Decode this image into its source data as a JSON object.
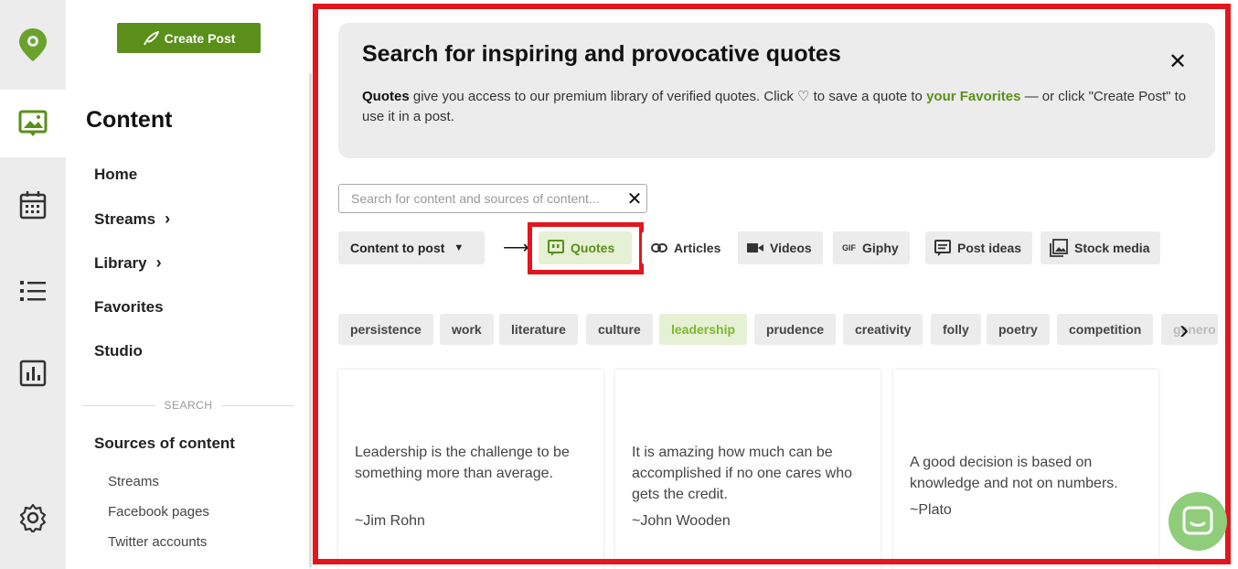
{
  "sidebar": {
    "create_post": "Create Post",
    "title": "Content",
    "nav": [
      {
        "label": "Home"
      },
      {
        "label": "Streams"
      },
      {
        "label": "Library"
      },
      {
        "label": "Favorites"
      },
      {
        "label": "Studio"
      }
    ],
    "search_divider": "SEARCH",
    "sources_heading": "Sources of content",
    "sources": [
      "Streams",
      "Facebook pages",
      "Twitter accounts"
    ]
  },
  "banner": {
    "title": "Search for inspiring and provocative quotes",
    "text_bold": "Quotes",
    "text_1": " give you access to our premium library of verified quotes. Click ♡ to save a quote to ",
    "text_link": "your Favorites",
    "text_2": " — or click \"Create Post\" to use it in a post."
  },
  "search": {
    "placeholder": "Search for content and sources of content..."
  },
  "content_dropdown": {
    "label": "Content to post"
  },
  "tabs": [
    {
      "label": "Quotes",
      "icon": "quote-icon"
    },
    {
      "label": "Articles",
      "icon": "link-icon"
    },
    {
      "label": "Videos",
      "icon": "video-icon"
    },
    {
      "label": "Giphy",
      "icon": "gif-icon"
    },
    {
      "label": "Post ideas",
      "icon": "post-ideas-icon"
    },
    {
      "label": "Stock media",
      "icon": "image-icon"
    }
  ],
  "tags": [
    "persistence",
    "work",
    "literature",
    "culture",
    "leadership",
    "prudence",
    "creativity",
    "folly",
    "poetry",
    "competition",
    "genero"
  ],
  "selected_tag": "leadership",
  "cards": [
    {
      "quote": "Leadership is the challenge to be something more than average.",
      "author": "~Jim Rohn"
    },
    {
      "quote": "It is amazing how much can be accomplished if no one cares who gets the credit.",
      "author": "~John Wooden"
    },
    {
      "quote": "A good decision is based on knowledge and not on numbers.",
      "author": "~Plato"
    }
  ],
  "colors": {
    "brand": "#5a8f1a",
    "highlight": "#e3151d",
    "tag_selected": "#7cb82f"
  }
}
